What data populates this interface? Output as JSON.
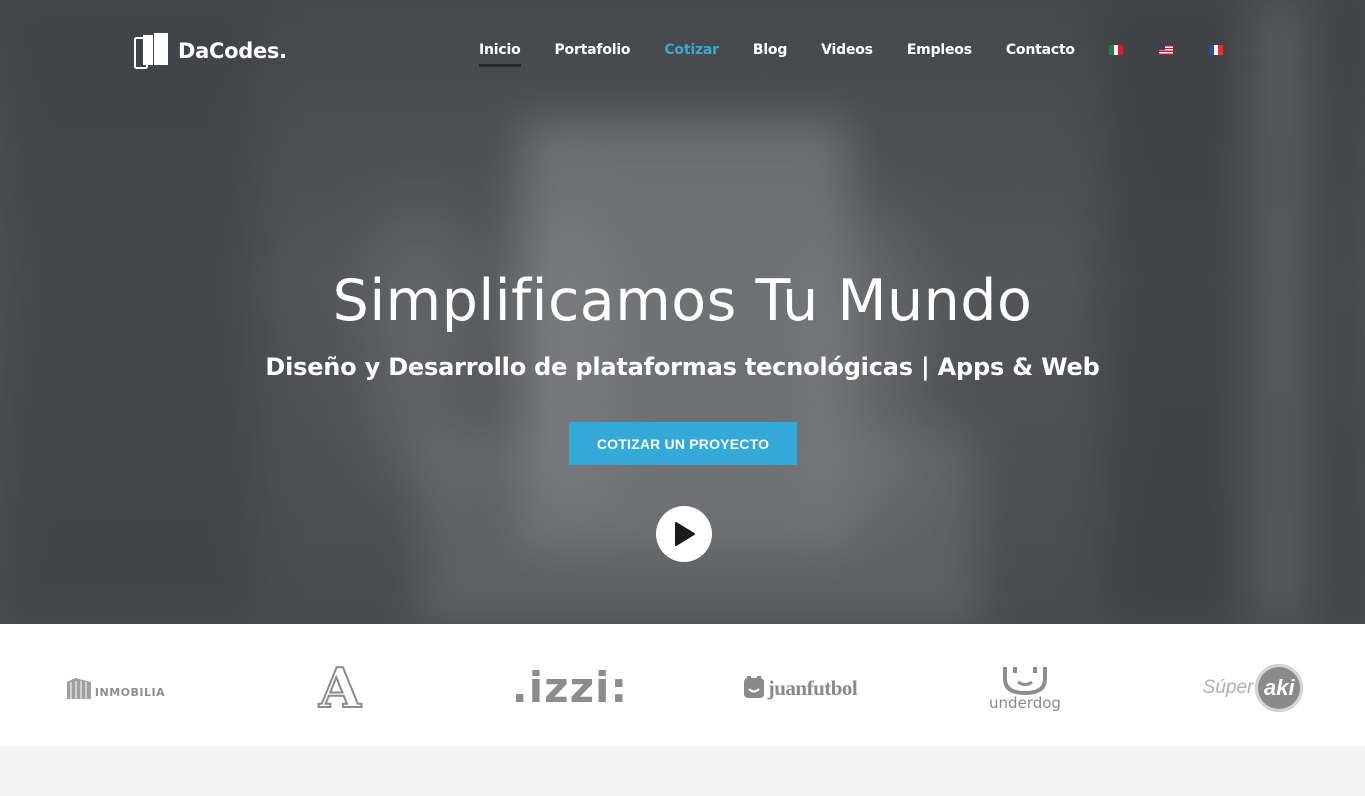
{
  "brand": {
    "name": "DaCodes."
  },
  "nav": {
    "items": [
      {
        "label": "Inicio",
        "state": "active"
      },
      {
        "label": "Portafolio",
        "state": "normal"
      },
      {
        "label": "Cotizar",
        "state": "highlight"
      },
      {
        "label": "Blog",
        "state": "normal"
      },
      {
        "label": "Videos",
        "state": "normal"
      },
      {
        "label": "Empleos",
        "state": "normal"
      },
      {
        "label": "Contacto",
        "state": "normal"
      }
    ],
    "flags": [
      "mexico-flag-icon",
      "usa-flag-icon",
      "france-flag-icon"
    ]
  },
  "hero": {
    "title": "Simplificamos Tu Mundo",
    "subtitle": "Diseño y Desarrollo de plataformas tecnológicas | Apps & Web",
    "cta_label": "COTIZAR UN PROYECTO",
    "play_icon": "play-icon"
  },
  "clients": {
    "inmobilia": "INMOBILIA",
    "a_logo": "A",
    "izzi": ".izzi:",
    "juanfutbol": "juanfutbol",
    "underdog": "underdog",
    "super": "Súper",
    "aki": "aki"
  },
  "colors": {
    "accent": "#34a9d8",
    "white": "#ffffff",
    "logo_gray": "#9a9a9a"
  }
}
